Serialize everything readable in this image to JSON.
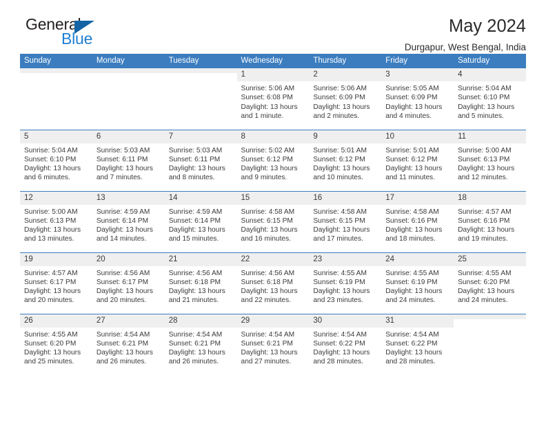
{
  "logo": {
    "word_one": "General",
    "word_two": "Blue",
    "triangle": "blue-triangle",
    "colors": {
      "dark": "#231f20",
      "blue": "#1f7fd0",
      "triangle": "#1464a5"
    }
  },
  "header": {
    "title": "May 2024",
    "subtitle": "Durgapur, West Bengal, India"
  },
  "theme": {
    "header_bar": "#3b7dbf",
    "daynum_band": "#efefef",
    "text": "#3a3a3a"
  },
  "weekday_headers": [
    "Sunday",
    "Monday",
    "Tuesday",
    "Wednesday",
    "Thursday",
    "Friday",
    "Saturday"
  ],
  "labels": {
    "sunrise": "Sunrise:",
    "sunset": "Sunset:",
    "daylight": "Daylight:"
  },
  "weeks": [
    [
      {
        "day": ""
      },
      {
        "day": ""
      },
      {
        "day": ""
      },
      {
        "day": "1",
        "sunrise": "Sunrise: 5:06 AM",
        "sunset": "Sunset: 6:08 PM",
        "daylight_1": "Daylight: 13 hours",
        "daylight_2": "and 1 minute."
      },
      {
        "day": "2",
        "sunrise": "Sunrise: 5:06 AM",
        "sunset": "Sunset: 6:09 PM",
        "daylight_1": "Daylight: 13 hours",
        "daylight_2": "and 2 minutes."
      },
      {
        "day": "3",
        "sunrise": "Sunrise: 5:05 AM",
        "sunset": "Sunset: 6:09 PM",
        "daylight_1": "Daylight: 13 hours",
        "daylight_2": "and 4 minutes."
      },
      {
        "day": "4",
        "sunrise": "Sunrise: 5:04 AM",
        "sunset": "Sunset: 6:10 PM",
        "daylight_1": "Daylight: 13 hours",
        "daylight_2": "and 5 minutes."
      }
    ],
    [
      {
        "day": "5",
        "sunrise": "Sunrise: 5:04 AM",
        "sunset": "Sunset: 6:10 PM",
        "daylight_1": "Daylight: 13 hours",
        "daylight_2": "and 6 minutes."
      },
      {
        "day": "6",
        "sunrise": "Sunrise: 5:03 AM",
        "sunset": "Sunset: 6:11 PM",
        "daylight_1": "Daylight: 13 hours",
        "daylight_2": "and 7 minutes."
      },
      {
        "day": "7",
        "sunrise": "Sunrise: 5:03 AM",
        "sunset": "Sunset: 6:11 PM",
        "daylight_1": "Daylight: 13 hours",
        "daylight_2": "and 8 minutes."
      },
      {
        "day": "8",
        "sunrise": "Sunrise: 5:02 AM",
        "sunset": "Sunset: 6:12 PM",
        "daylight_1": "Daylight: 13 hours",
        "daylight_2": "and 9 minutes."
      },
      {
        "day": "9",
        "sunrise": "Sunrise: 5:01 AM",
        "sunset": "Sunset: 6:12 PM",
        "daylight_1": "Daylight: 13 hours",
        "daylight_2": "and 10 minutes."
      },
      {
        "day": "10",
        "sunrise": "Sunrise: 5:01 AM",
        "sunset": "Sunset: 6:12 PM",
        "daylight_1": "Daylight: 13 hours",
        "daylight_2": "and 11 minutes."
      },
      {
        "day": "11",
        "sunrise": "Sunrise: 5:00 AM",
        "sunset": "Sunset: 6:13 PM",
        "daylight_1": "Daylight: 13 hours",
        "daylight_2": "and 12 minutes."
      }
    ],
    [
      {
        "day": "12",
        "sunrise": "Sunrise: 5:00 AM",
        "sunset": "Sunset: 6:13 PM",
        "daylight_1": "Daylight: 13 hours",
        "daylight_2": "and 13 minutes."
      },
      {
        "day": "13",
        "sunrise": "Sunrise: 4:59 AM",
        "sunset": "Sunset: 6:14 PM",
        "daylight_1": "Daylight: 13 hours",
        "daylight_2": "and 14 minutes."
      },
      {
        "day": "14",
        "sunrise": "Sunrise: 4:59 AM",
        "sunset": "Sunset: 6:14 PM",
        "daylight_1": "Daylight: 13 hours",
        "daylight_2": "and 15 minutes."
      },
      {
        "day": "15",
        "sunrise": "Sunrise: 4:58 AM",
        "sunset": "Sunset: 6:15 PM",
        "daylight_1": "Daylight: 13 hours",
        "daylight_2": "and 16 minutes."
      },
      {
        "day": "16",
        "sunrise": "Sunrise: 4:58 AM",
        "sunset": "Sunset: 6:15 PM",
        "daylight_1": "Daylight: 13 hours",
        "daylight_2": "and 17 minutes."
      },
      {
        "day": "17",
        "sunrise": "Sunrise: 4:58 AM",
        "sunset": "Sunset: 6:16 PM",
        "daylight_1": "Daylight: 13 hours",
        "daylight_2": "and 18 minutes."
      },
      {
        "day": "18",
        "sunrise": "Sunrise: 4:57 AM",
        "sunset": "Sunset: 6:16 PM",
        "daylight_1": "Daylight: 13 hours",
        "daylight_2": "and 19 minutes."
      }
    ],
    [
      {
        "day": "19",
        "sunrise": "Sunrise: 4:57 AM",
        "sunset": "Sunset: 6:17 PM",
        "daylight_1": "Daylight: 13 hours",
        "daylight_2": "and 20 minutes."
      },
      {
        "day": "20",
        "sunrise": "Sunrise: 4:56 AM",
        "sunset": "Sunset: 6:17 PM",
        "daylight_1": "Daylight: 13 hours",
        "daylight_2": "and 20 minutes."
      },
      {
        "day": "21",
        "sunrise": "Sunrise: 4:56 AM",
        "sunset": "Sunset: 6:18 PM",
        "daylight_1": "Daylight: 13 hours",
        "daylight_2": "and 21 minutes."
      },
      {
        "day": "22",
        "sunrise": "Sunrise: 4:56 AM",
        "sunset": "Sunset: 6:18 PM",
        "daylight_1": "Daylight: 13 hours",
        "daylight_2": "and 22 minutes."
      },
      {
        "day": "23",
        "sunrise": "Sunrise: 4:55 AM",
        "sunset": "Sunset: 6:19 PM",
        "daylight_1": "Daylight: 13 hours",
        "daylight_2": "and 23 minutes."
      },
      {
        "day": "24",
        "sunrise": "Sunrise: 4:55 AM",
        "sunset": "Sunset: 6:19 PM",
        "daylight_1": "Daylight: 13 hours",
        "daylight_2": "and 24 minutes."
      },
      {
        "day": "25",
        "sunrise": "Sunrise: 4:55 AM",
        "sunset": "Sunset: 6:20 PM",
        "daylight_1": "Daylight: 13 hours",
        "daylight_2": "and 24 minutes."
      }
    ],
    [
      {
        "day": "26",
        "sunrise": "Sunrise: 4:55 AM",
        "sunset": "Sunset: 6:20 PM",
        "daylight_1": "Daylight: 13 hours",
        "daylight_2": "and 25 minutes."
      },
      {
        "day": "27",
        "sunrise": "Sunrise: 4:54 AM",
        "sunset": "Sunset: 6:21 PM",
        "daylight_1": "Daylight: 13 hours",
        "daylight_2": "and 26 minutes."
      },
      {
        "day": "28",
        "sunrise": "Sunrise: 4:54 AM",
        "sunset": "Sunset: 6:21 PM",
        "daylight_1": "Daylight: 13 hours",
        "daylight_2": "and 26 minutes."
      },
      {
        "day": "29",
        "sunrise": "Sunrise: 4:54 AM",
        "sunset": "Sunset: 6:21 PM",
        "daylight_1": "Daylight: 13 hours",
        "daylight_2": "and 27 minutes."
      },
      {
        "day": "30",
        "sunrise": "Sunrise: 4:54 AM",
        "sunset": "Sunset: 6:22 PM",
        "daylight_1": "Daylight: 13 hours",
        "daylight_2": "and 28 minutes."
      },
      {
        "day": "31",
        "sunrise": "Sunrise: 4:54 AM",
        "sunset": "Sunset: 6:22 PM",
        "daylight_1": "Daylight: 13 hours",
        "daylight_2": "and 28 minutes."
      },
      {
        "day": ""
      }
    ]
  ]
}
